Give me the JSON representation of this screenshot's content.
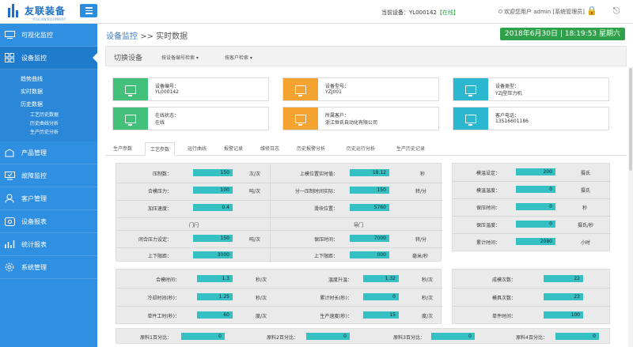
{
  "app": {
    "logo_text": "友联装备",
    "logo_sub": "YOULIAN EQUIPMENT"
  },
  "header": {
    "device_label": "当前设备：",
    "device_id": "YL000142",
    "device_status": "【在线】",
    "welcome": "欢迎您用户 admin [系统管理员]"
  },
  "sidebar": {
    "items": [
      {
        "label": "可视化监控",
        "icon": "monitor-icon"
      },
      {
        "label": "设备监控",
        "icon": "device-grid-icon"
      },
      {
        "label": "产品管理",
        "icon": "product-icon"
      },
      {
        "label": "故障监控",
        "icon": "fault-icon"
      },
      {
        "label": "客户管理",
        "icon": "user-icon"
      },
      {
        "label": "设备报表",
        "icon": "report-icon"
      },
      {
        "label": "统计报表",
        "icon": "stats-icon"
      },
      {
        "label": "系统管理",
        "icon": "gear-icon"
      }
    ],
    "sub": {
      "a": "趋势曲线",
      "b": "实时数据",
      "c": "历史数据",
      "c1": "工艺历史数据",
      "c2": "历史曲线分析",
      "c3": "生产历史分析"
    }
  },
  "breadcrumb": {
    "parent": "设备监控",
    "sep": ">>",
    "current": "实时数据"
  },
  "clock": "2018年6月30日 | 18:19:53 星期六",
  "toolbar": {
    "title": "切换设备",
    "dd1": "按设备编号检索",
    "dd2": "按客户检索"
  },
  "cards": [
    {
      "k": "设备编号：",
      "v": "YL000142",
      "color": "#43c17b"
    },
    {
      "k": "设备型号：",
      "v": "YZJ001",
      "color": "#f4a331"
    },
    {
      "k": "设备类型：",
      "v": "YZJ型压力机",
      "color": "#2bb8cf"
    },
    {
      "k": "在线状态：",
      "v": "在线",
      "color": "#43c17b"
    },
    {
      "k": "所属客户：",
      "v": "浙江恒氏自动化有限公司",
      "color": "#f4a331"
    },
    {
      "k": "客户电话：",
      "v": "13516601186",
      "color": "#2bb8cf"
    }
  ],
  "tabs": [
    "生产参数",
    "工艺参数",
    "运行曲线",
    "报警记录",
    "维修日志",
    "历史报警分析",
    "历史运行分析",
    "生产历史记录"
  ],
  "panel1": {
    "rows": [
      {
        "l1": "压制数：",
        "v1": "150",
        "u1": "次/次",
        "l2": "上模位置实时值：",
        "v2": "18.12",
        "u2": "秒"
      },
      {
        "l1": "合模压力：",
        "v1": "100",
        "u1": "吨/次",
        "l2": "分一压制时间实际：",
        "v2": "150",
        "u2": "转/分"
      },
      {
        "l1": "加压速度：",
        "v1": "0.4",
        "u1": "",
        "l2": "滑块位置：",
        "v2": "5760",
        "u2": ""
      }
    ],
    "lbl_left": "门闩",
    "lbl_right": "导门",
    "rows2": [
      {
        "l1": "闭合压力设定：",
        "v1": "150",
        "u1": "吨/次",
        "l2": "保压时间：",
        "v2": "7000",
        "u2": "转/分"
      },
      {
        "l1": "上下限距：",
        "v1": "3000",
        "u1": "",
        "l2": "上下限距：",
        "v2": "000",
        "u2": "毫米/秒"
      }
    ]
  },
  "panel2": {
    "rows": [
      {
        "l": "模温设定：",
        "v": "200",
        "u": "摄氏"
      },
      {
        "l": "模温温度：",
        "v": "0",
        "u": "摄氏"
      },
      {
        "l": "保压时间：",
        "v": "0",
        "u": "秒"
      },
      {
        "l": "保压温度：",
        "v": "0",
        "u": "摄氏/秒"
      },
      {
        "l": "累计时间：",
        "v": "2080",
        "u": "小时"
      }
    ]
  },
  "panel3": {
    "rows": [
      {
        "l1": "合模时间：",
        "v1": "1.3",
        "u1": "秒/次",
        "l2": "温度升温：",
        "v2": "1.32",
        "u2": "秒/次"
      },
      {
        "l1": "冷却时间(秒)：",
        "v1": "1.25",
        "u1": "秒/次",
        "l2": "累计时长(秒)：",
        "v2": "0",
        "u2": "秒/次"
      },
      {
        "l1": "单件工时(秒)：",
        "v1": "60",
        "u1": "度/次",
        "l2": "生产速度(秒)：",
        "v2": "15",
        "u2": "度/次"
      }
    ]
  },
  "panel4": {
    "rows": [
      {
        "l": "成模次数：",
        "v": "22"
      },
      {
        "l": "模具次数：",
        "v": "23"
      },
      {
        "l": "单件时间：",
        "v": "100"
      }
    ]
  },
  "panel5": {
    "items": [
      {
        "l": "原料1百分比：",
        "v": "0"
      },
      {
        "l": "原料2百分比：",
        "v": "0"
      },
      {
        "l": "原料3百分比：",
        "v": "0"
      },
      {
        "l": "原料4百分比：",
        "v": "0"
      }
    ]
  }
}
